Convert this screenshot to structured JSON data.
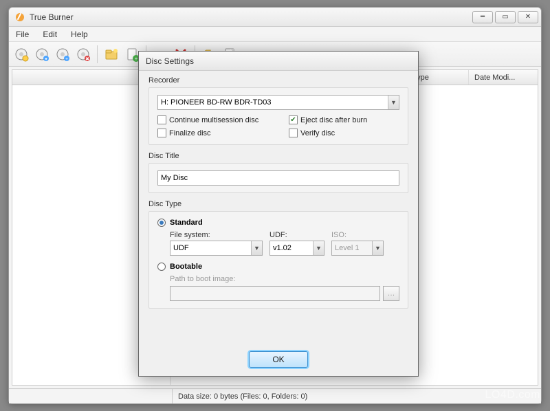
{
  "window": {
    "title": "True Burner",
    "menu": [
      "File",
      "Edit",
      "Help"
    ],
    "columns": {
      "type": "Type",
      "date": "Date Modi..."
    },
    "status": "Data size: 0 bytes (Files: 0, Folders: 0)"
  },
  "toolbar": {
    "buttons": [
      "new-disc",
      "add-disc",
      "import-disc",
      "disc-settings",
      "new-folder",
      "add-file",
      "rename",
      "delete",
      "open",
      "blank-disc"
    ]
  },
  "dialog": {
    "title": "Disc Settings",
    "recorder": {
      "label": "Recorder",
      "selected": "H: PIONEER BD-RW   BDR-TD03",
      "continue_label": "Continue multisession disc",
      "continue_checked": false,
      "finalize_label": "Finalize disc",
      "finalize_checked": false,
      "eject_label": "Eject disc after burn",
      "eject_checked": true,
      "verify_label": "Verify disc",
      "verify_checked": false
    },
    "disc_title": {
      "label": "Disc Title",
      "value": "My Disc"
    },
    "disc_type": {
      "label": "Disc Type",
      "standard_label": "Standard",
      "bootable_label": "Bootable",
      "selected": "standard",
      "fs_label": "File system:",
      "fs_value": "UDF",
      "udf_label": "UDF:",
      "udf_value": "v1.02",
      "iso_label": "ISO:",
      "iso_value": "Level 1",
      "boot_path_label": "Path to boot image:",
      "boot_path_value": ""
    },
    "ok_label": "OK"
  },
  "watermark": "LO4D.com"
}
